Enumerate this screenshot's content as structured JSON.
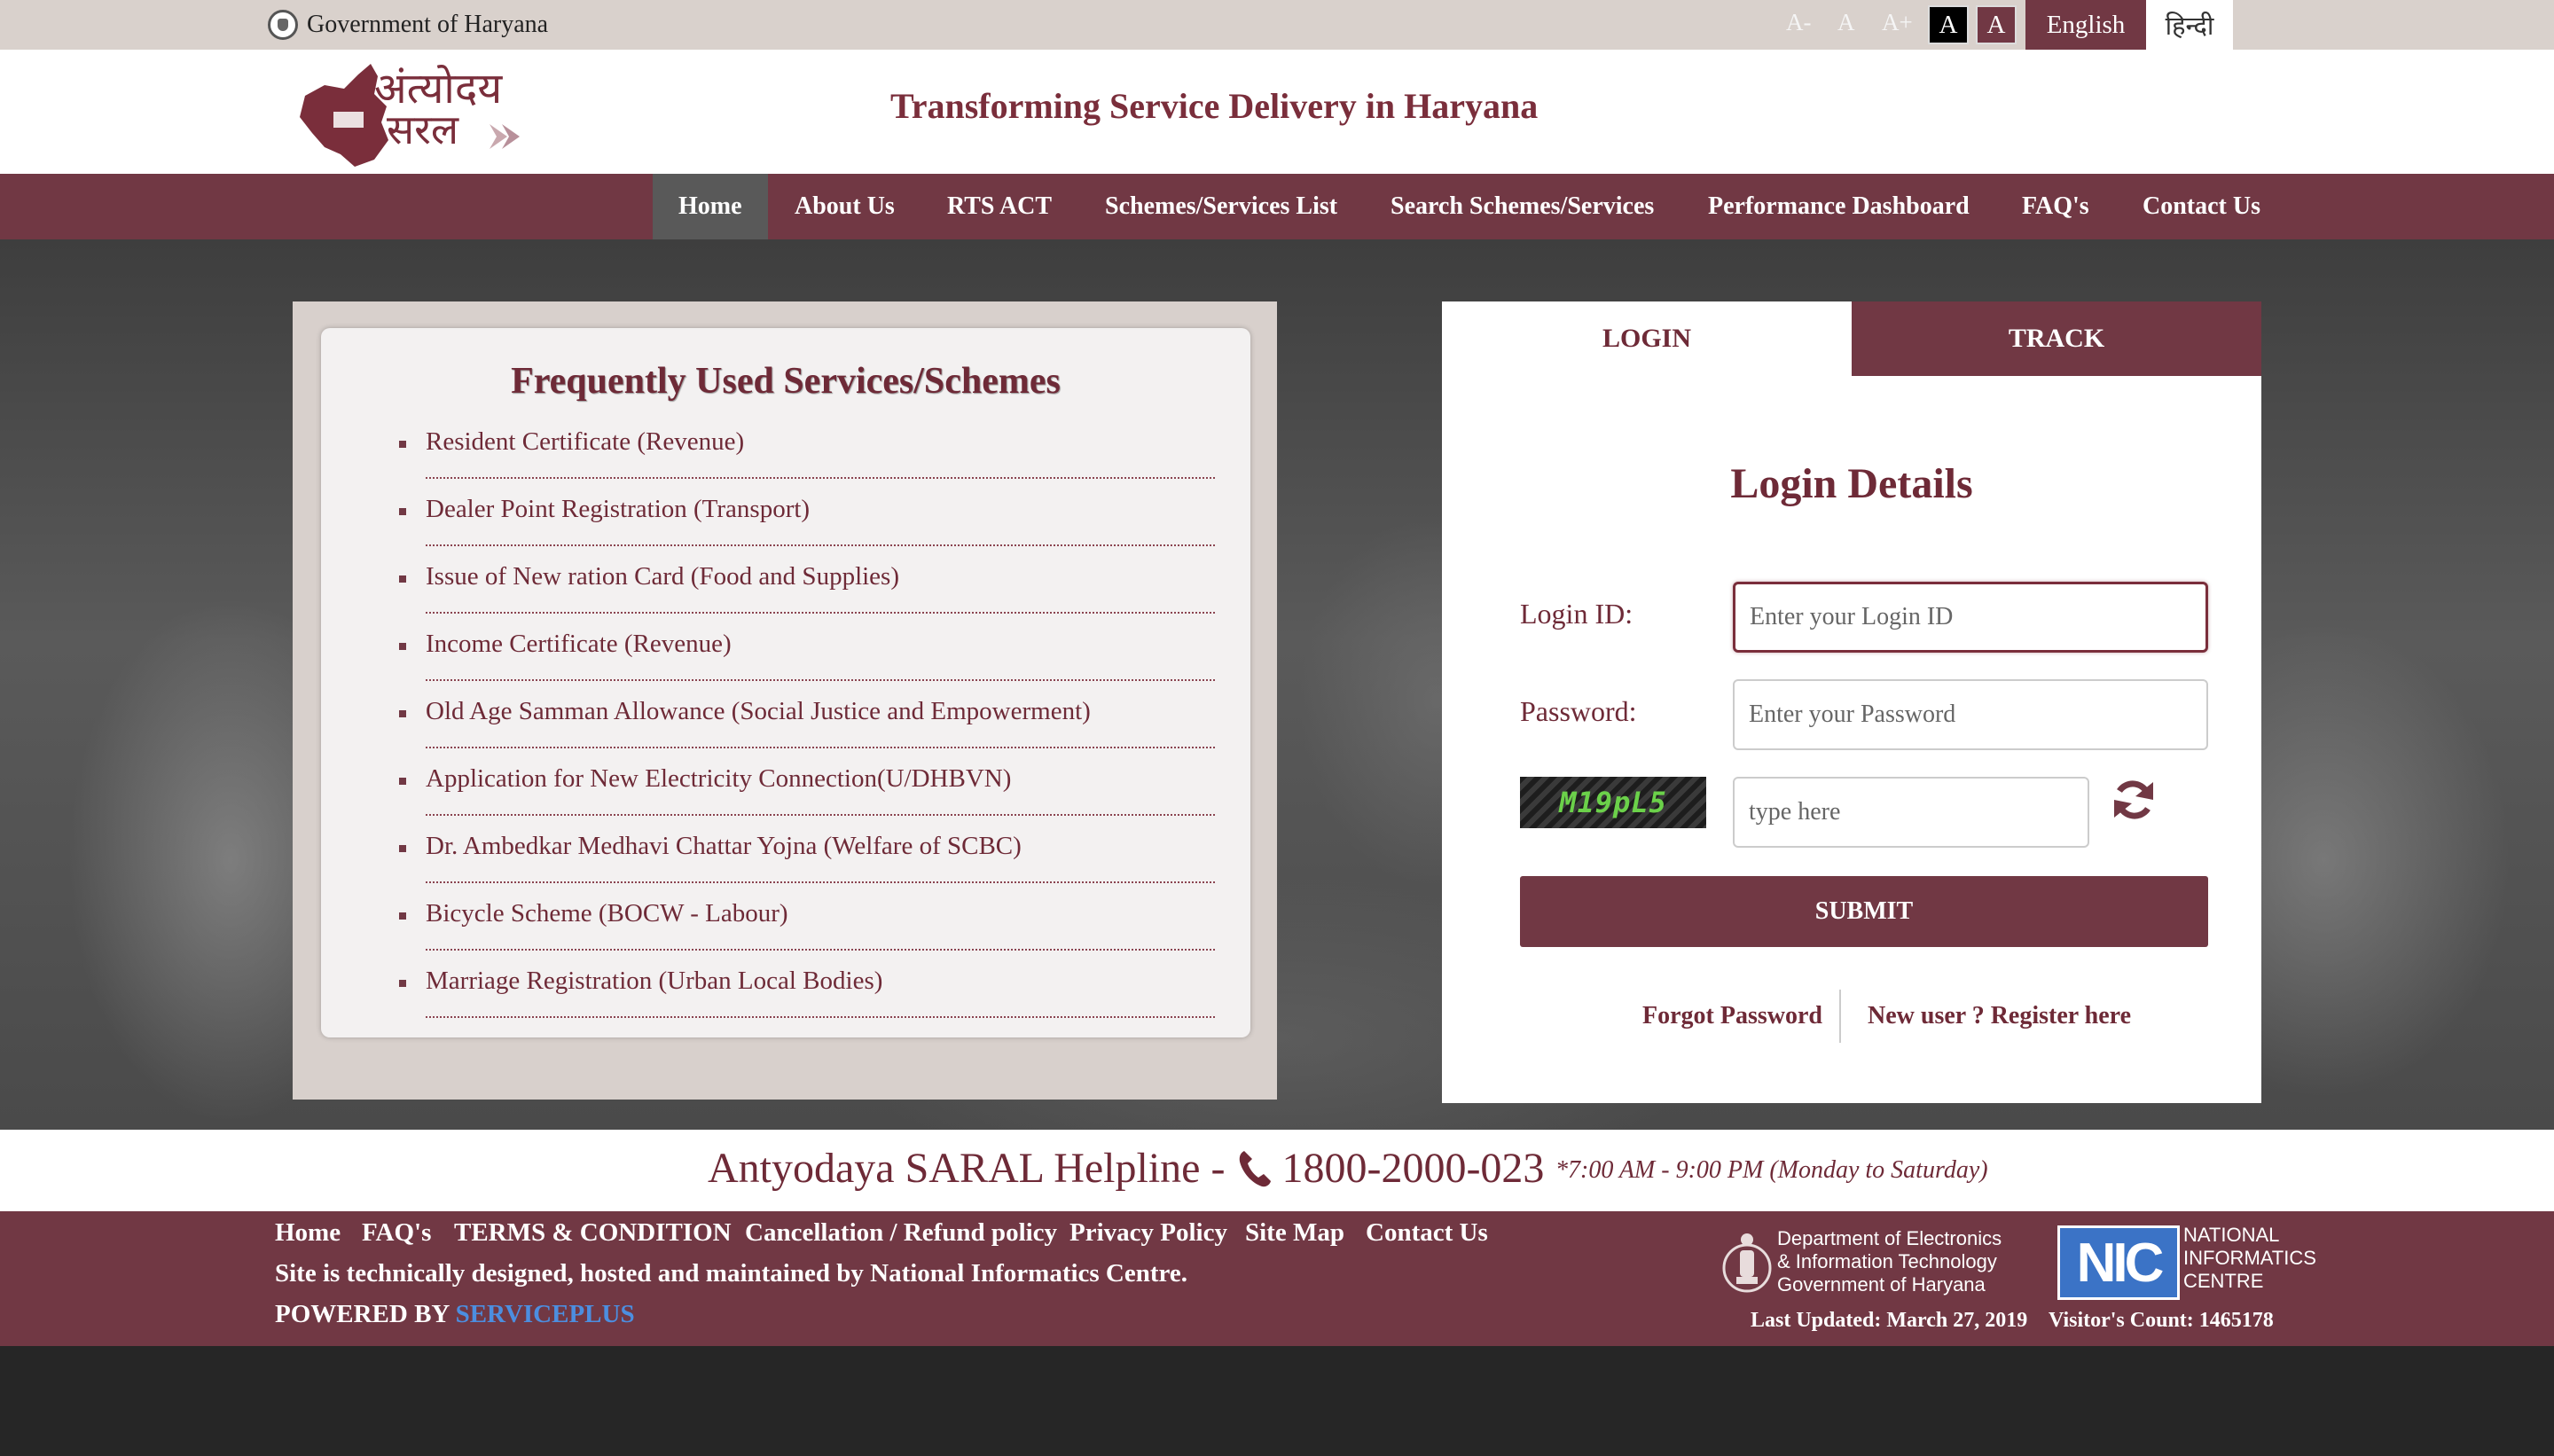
{
  "topbar": {
    "gov_label": "Government of Haryana",
    "font_controls": [
      "A-",
      "A",
      "A+"
    ],
    "contrast_buttons": [
      "A",
      "A"
    ],
    "languages": [
      "English",
      "हिन्दी"
    ]
  },
  "header": {
    "logo_line1": "अंत्योदय",
    "logo_line2": "सरल",
    "tagline": "Transforming Service Delivery in Haryana"
  },
  "nav": {
    "items": [
      "Home",
      "About Us",
      "RTS ACT",
      "Schemes/Services List",
      "Search Schemes/Services",
      "Performance Dashboard",
      "FAQ's",
      "Contact Us"
    ],
    "active": "Home"
  },
  "services": {
    "title": "Frequently Used Services/Schemes",
    "items": [
      "Resident Certificate (Revenue)",
      "Dealer Point Registration (Transport)",
      "Issue of New ration Card (Food and Supplies)",
      "Income Certificate (Revenue)",
      "Old Age Samman Allowance (Social Justice and Empowerment)",
      "Application for New Electricity Connection(U/DHBVN)",
      "Dr. Ambedkar Medhavi Chattar Yojna (Welfare of SCBC)",
      "Bicycle Scheme (BOCW - Labour)",
      "Marriage Registration (Urban Local Bodies)"
    ]
  },
  "login": {
    "tabs": [
      "LOGIN",
      "TRACK"
    ],
    "title": "Login Details",
    "login_id_label": "Login ID:",
    "login_id_placeholder": "Enter your Login ID",
    "password_label": "Password:",
    "password_placeholder": "Enter your Password",
    "captcha_text": "M19pL5",
    "captcha_placeholder": "type here",
    "submit_label": "SUBMIT",
    "forgot_password": "Forgot Password",
    "register": "New user ? Register here"
  },
  "helpline": {
    "prefix": "Antyodaya SARAL Helpline -",
    "number": "1800-2000-023",
    "hours": "*7:00 AM - 9:00 PM (Monday to Saturday)"
  },
  "footer": {
    "links": [
      "Home",
      "FAQ's",
      "TERMS & CONDITION",
      "Cancellation / Refund policy",
      "Privacy Policy",
      "Site Map",
      "Contact Us"
    ],
    "hosted_text": "Site is technically designed, hosted and maintained by National Informatics Centre.",
    "powered_by": "POWERED BY",
    "powered_brand": "SERVICEPLUS",
    "deity_lines": [
      "Department of Electronics",
      "& Information Technology",
      "Government of Haryana"
    ],
    "nic_abbr": "NIC",
    "nic_lines": [
      "NATIONAL",
      "INFORMATICS",
      "CENTRE"
    ],
    "last_updated": "Last Updated: March 27, 2019",
    "visitor_count": "Visitor's Count: 1465178"
  },
  "colors": {
    "brand_maroon": "#713844",
    "text_maroon": "#6e2a37",
    "topbar_bg": "#d9d1cc",
    "active_nav_bg": "#595959",
    "serviceplus_blue": "#4c8ee0"
  },
  "icons": [
    "haryana-emblem-icon",
    "phone-icon",
    "refresh-icon",
    "deity-emblem-icon",
    "nic-logo"
  ]
}
